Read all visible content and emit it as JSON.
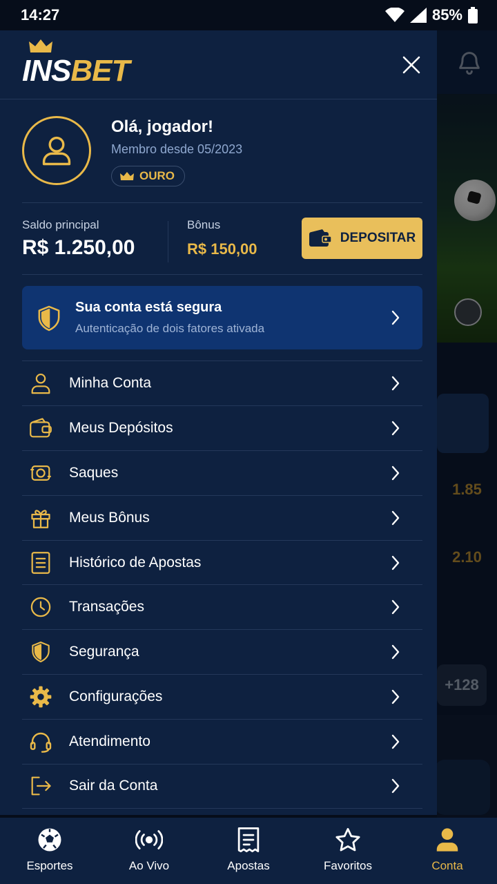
{
  "status_bar": {
    "time": "14:27",
    "battery": "85%"
  },
  "brand": {
    "part1": "INS",
    "part2": "BET"
  },
  "profile": {
    "greeting": "Olá, jogador!",
    "member_since": "Membro desde 05/2023",
    "tier": "OURO"
  },
  "balance": {
    "main_label": "Saldo principal",
    "main_value": "R$ 1.250,00",
    "bonus_label": "Bônus",
    "bonus_value": "R$ 150,00",
    "deposit_label": "DEPOSITAR"
  },
  "security": {
    "title": "Sua conta está segura",
    "subtitle": "Autenticação de dois fatores ativada"
  },
  "menu": [
    {
      "label": "Minha Conta",
      "icon": "user-icon"
    },
    {
      "label": "Meus Depósitos",
      "icon": "wallet-icon"
    },
    {
      "label": "Saques",
      "icon": "withdraw-icon"
    },
    {
      "label": "Meus Bônus",
      "icon": "gift-icon"
    },
    {
      "label": "Histórico de Apostas",
      "icon": "document-icon"
    },
    {
      "label": "Transações",
      "icon": "clock-icon"
    },
    {
      "label": "Segurança",
      "icon": "shield-icon"
    },
    {
      "label": "Configurações",
      "icon": "gear-icon"
    },
    {
      "label": "Atendimento",
      "icon": "headset-icon"
    },
    {
      "label": "Sair da Conta",
      "icon": "logout-icon"
    }
  ],
  "background": {
    "odd1": "1.85",
    "odd2": "2.10",
    "more": "+128"
  },
  "bottom_nav": [
    {
      "label": "Esportes",
      "icon": "soccer-ball-icon"
    },
    {
      "label": "Ao Vivo",
      "icon": "live-icon"
    },
    {
      "label": "Apostas",
      "icon": "betslip-icon"
    },
    {
      "label": "Favoritos",
      "icon": "star-icon"
    },
    {
      "label": "Conta",
      "icon": "user-icon"
    }
  ],
  "colors": {
    "accent": "#e9b949",
    "drawer": "#0e2140",
    "security_card": "#0f3471"
  }
}
